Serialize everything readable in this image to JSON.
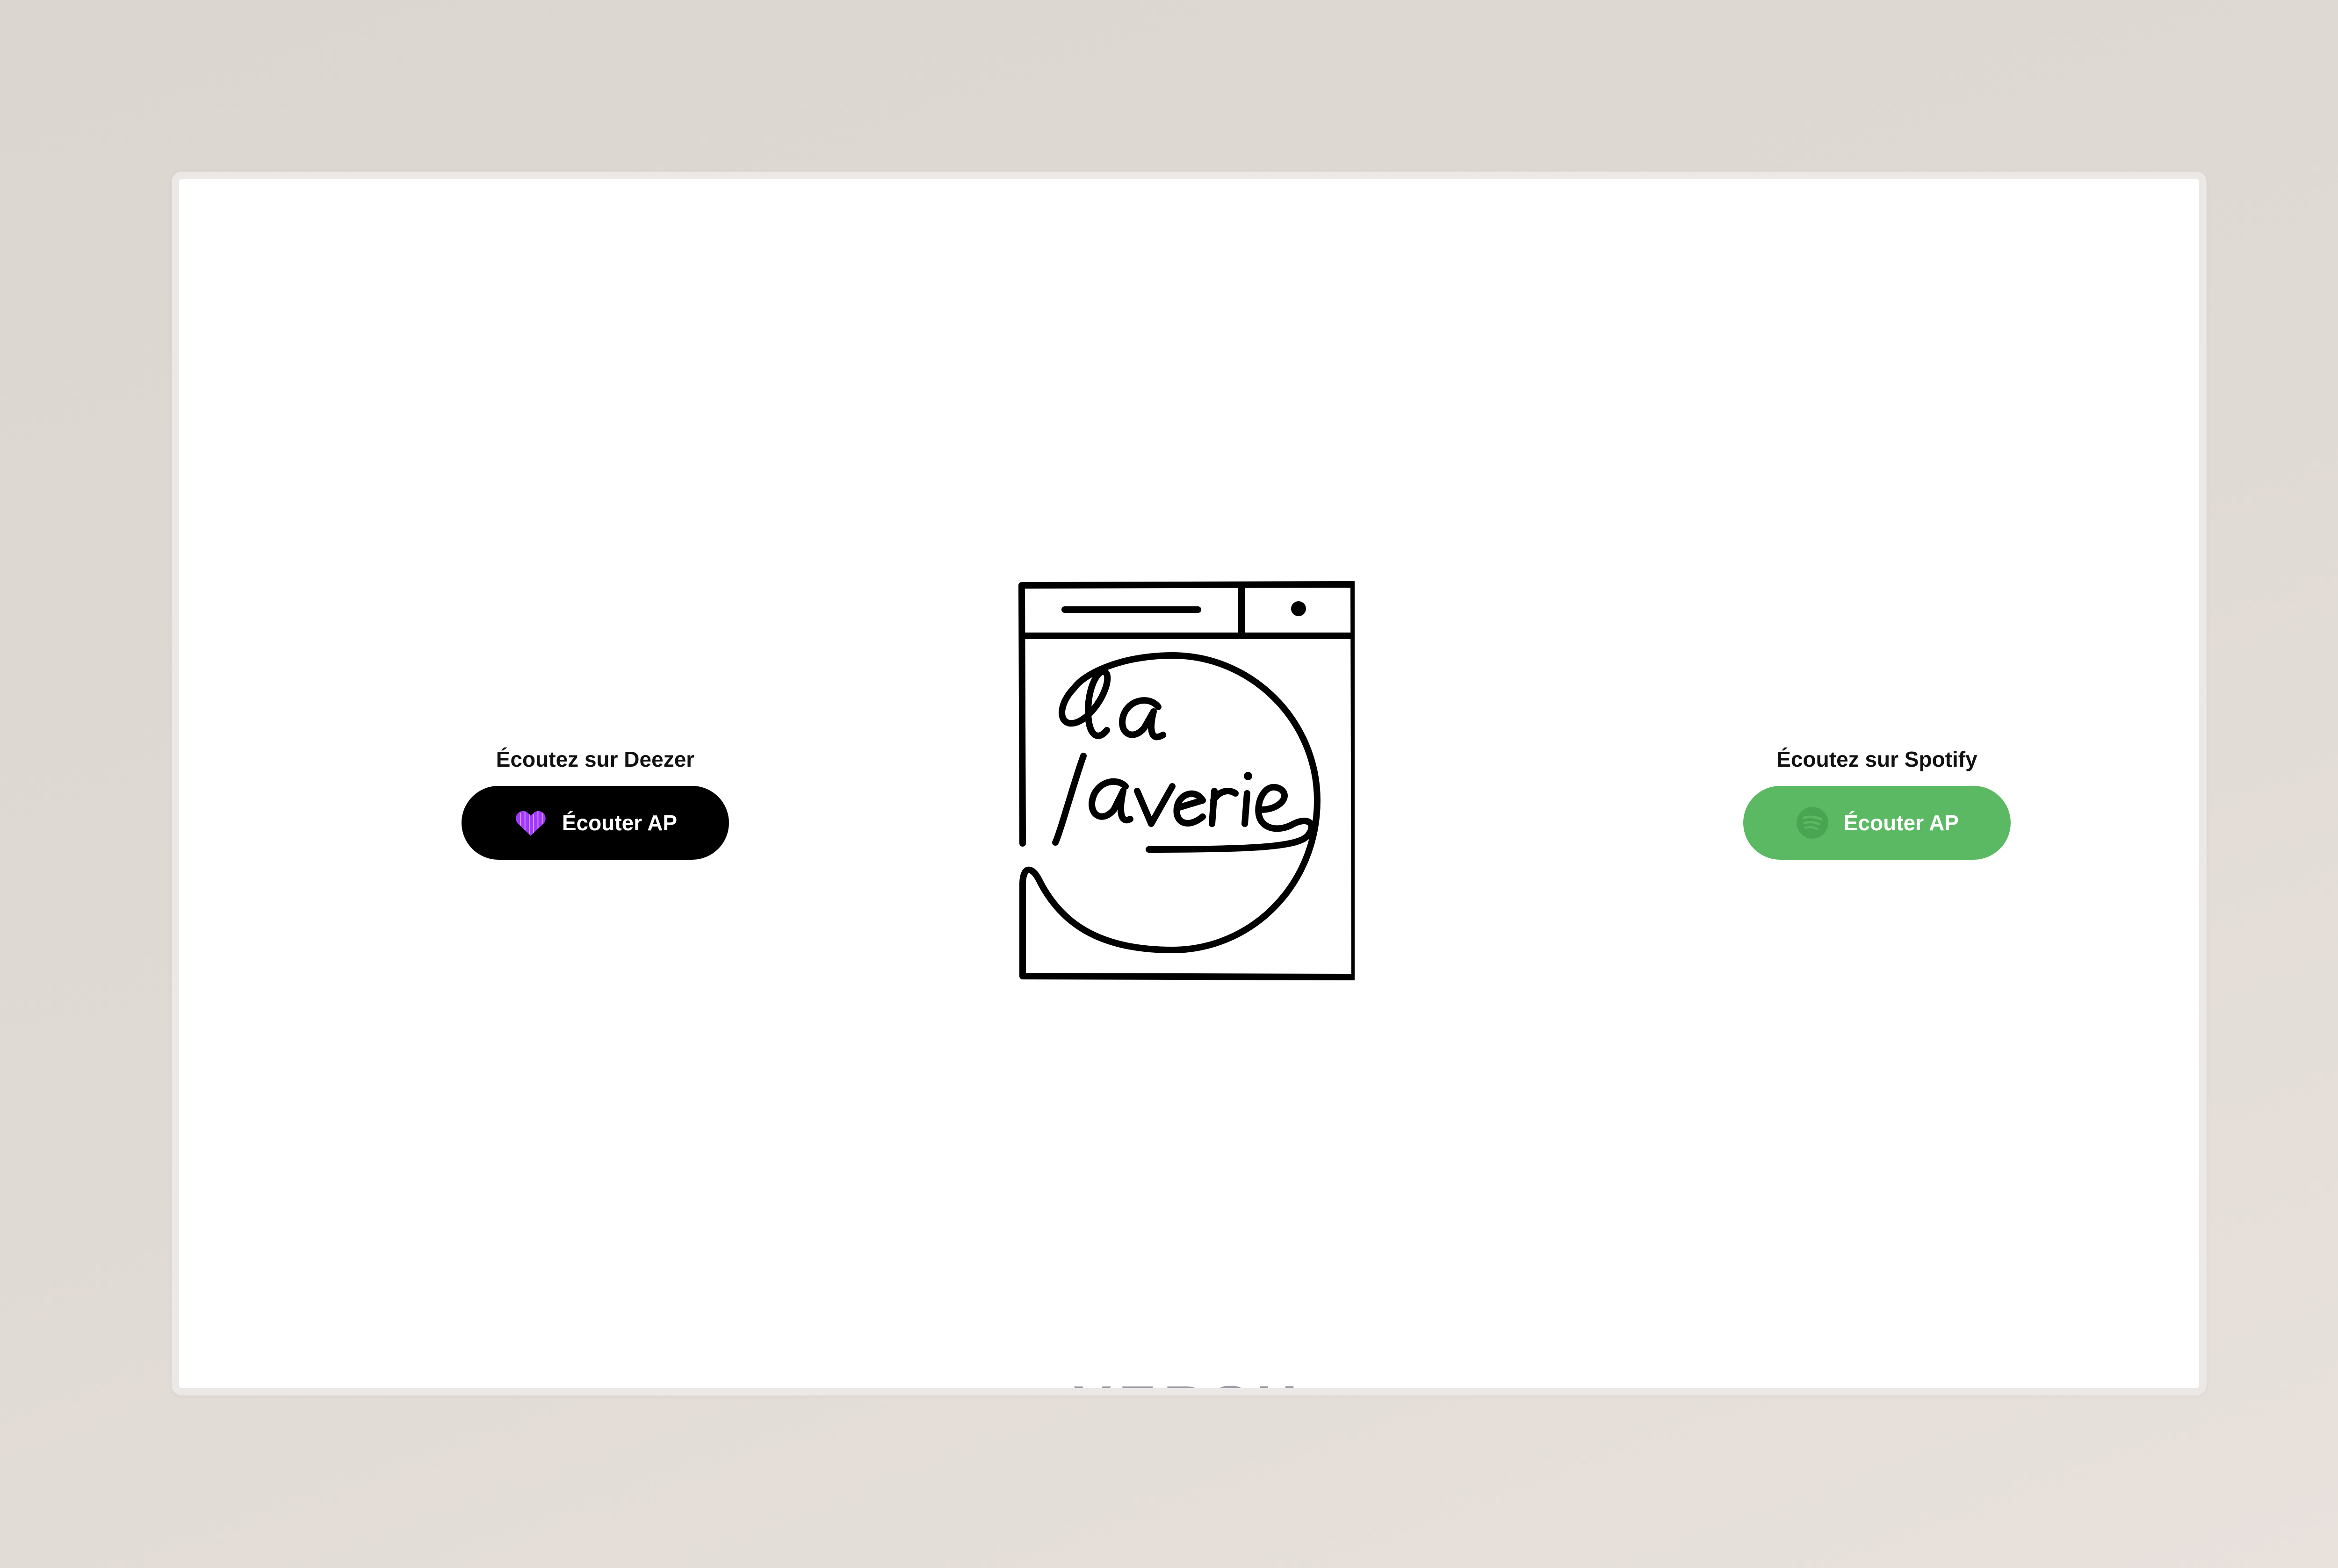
{
  "deezer": {
    "heading": "Écoutez sur Deezer",
    "button_label": "Écouter AP",
    "icon": "deezer-heart-icon",
    "button_color": "#000000",
    "icon_color": "#a238ff"
  },
  "spotify": {
    "heading": "Écoutez sur Spotify",
    "button_label": "Écouter AP",
    "icon": "spotify-icon",
    "button_color": "#5cb963"
  },
  "logo": {
    "text": "la laverie",
    "icon": "washing-machine-logo"
  },
  "bottom_peek": {
    "text": "VERSU"
  }
}
